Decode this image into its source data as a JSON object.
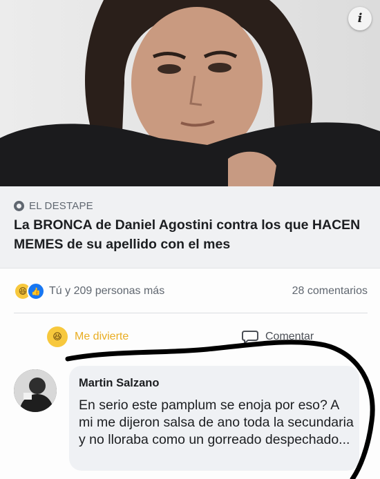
{
  "post": {
    "info_glyph": "i",
    "source": "EL DESTAPE",
    "headline": "La BRONCA de Daniel Agostini contra los que HACEN MEMES de su apellido con el mes",
    "reactions_text": "Tú y 209 personas más",
    "comments_count": "28 comentarios"
  },
  "actions": {
    "react_label": "Me divierte",
    "comment_label": "Comentar"
  },
  "comment": {
    "author": "Martin Salzano",
    "text": "En serio este pamplum se enoja por eso? A mi me dijeron salsa de ano toda la secundaria y no lloraba como un gorreado despechado..."
  },
  "colors": {
    "reaction_accent": "#e9ad22",
    "like_blue": "#1877f2",
    "scribble": "#000000"
  },
  "icons": {
    "info": "info-icon",
    "source": "globe-icon",
    "haha": "haha-reaction-icon",
    "like": "like-reaction-icon",
    "comment": "comment-bubble-icon"
  }
}
